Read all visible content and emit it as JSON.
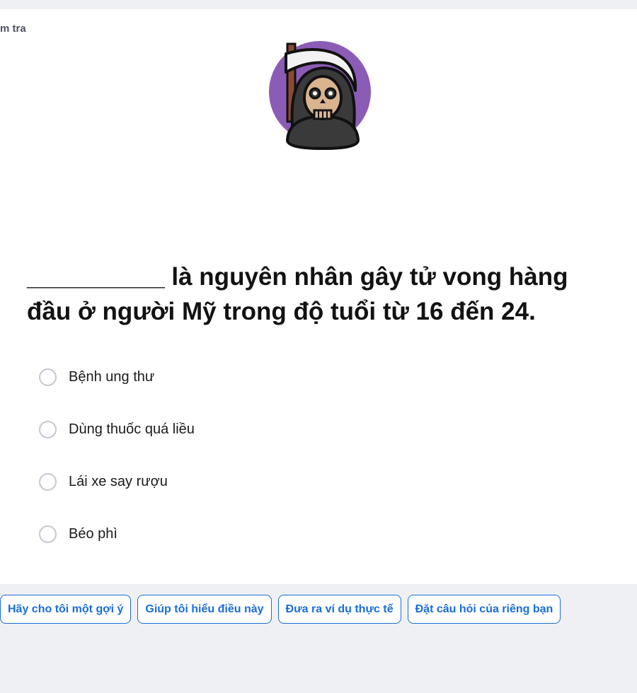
{
  "header": {
    "breadcrumb": "m tra"
  },
  "illustration": {
    "icon": "grim-reaper-icon",
    "colors": {
      "circle": "#8b5cb6",
      "hood": "#3a3a3a",
      "skull": "#d9b48f",
      "scythe_blade": "#f2f2f2",
      "scythe_handle": "#8b4a32"
    }
  },
  "question": {
    "blank": "__________",
    "text": "là nguyên nhân gây tử vong hàng đầu ở người Mỹ trong độ tuổi từ 16 đến 24."
  },
  "options": [
    {
      "label": "Bệnh ung thư",
      "selected": false
    },
    {
      "label": "Dùng thuốc quá liều",
      "selected": false
    },
    {
      "label": "Lái xe say rượu",
      "selected": false
    },
    {
      "label": "Béo phì",
      "selected": false
    }
  ],
  "help_chips": [
    {
      "label": "Hãy cho tôi một gợi ý"
    },
    {
      "label": "Giúp tôi hiểu điều này"
    },
    {
      "label": "Đưa ra ví dụ thực tế"
    },
    {
      "label": "Đặt câu hỏi của riêng bạn"
    }
  ],
  "colors": {
    "accent": "#1a6ed8",
    "page_background": "#eff0f4",
    "card_background": "#ffffff"
  }
}
